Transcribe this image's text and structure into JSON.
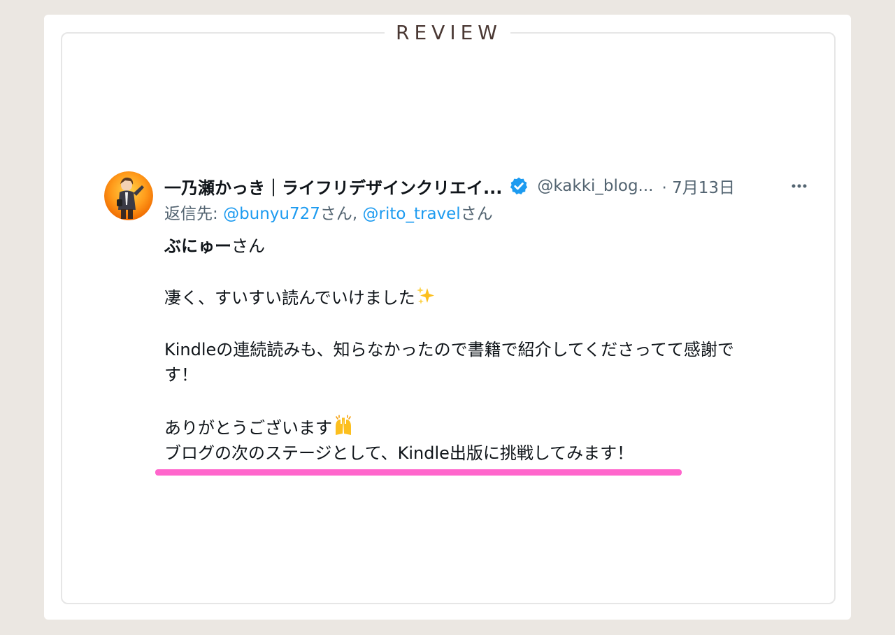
{
  "section": {
    "label": "REVIEW"
  },
  "tweet": {
    "author": {
      "display_name": "一乃瀬かっき｜ライフリデザインクリエイ...",
      "handle": "@kakki_blog...",
      "verified": true
    },
    "date": "· 7月13日",
    "more_icon": "more-horizontal-icon",
    "reply": {
      "prefix": "返信先: ",
      "mention1": "@bunyu727",
      "suffix1": "さん, ",
      "mention2": "@rito_travel",
      "suffix2": "さん"
    },
    "body": {
      "greeting_name": "ぶにゅー",
      "greeting_suffix": "さん",
      "line1": "凄く、すいすい読んでいけました",
      "line2": "Kindleの連続読みも、知らなかったので書籍で紹介してくださってて感謝で",
      "line3": "す！",
      "line4": "ありがとうございます",
      "line5": "ブログの次のステージとして、Kindle出版に挑戦してみます！"
    }
  },
  "colors": {
    "background": "#ebe7e2",
    "review_text": "#4a3833",
    "mention": "#1d9bf0",
    "verified": "#1d9bf0",
    "highlight": "#ff66cc"
  }
}
